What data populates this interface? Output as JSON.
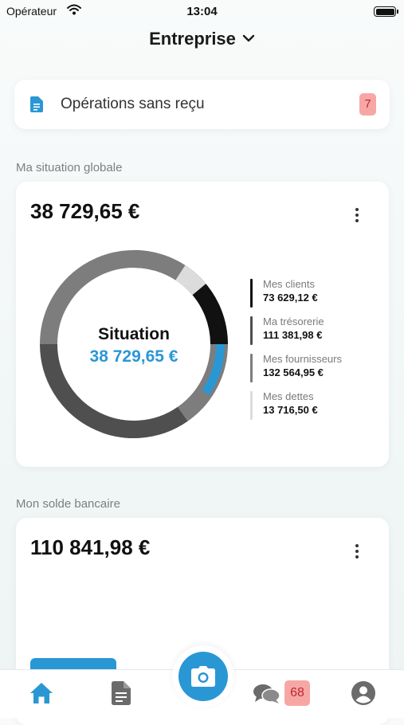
{
  "status_bar": {
    "carrier": "Opérateur",
    "time": "13:04"
  },
  "header": {
    "title": "Entreprise"
  },
  "receipts": {
    "label": "Opérations sans reçu",
    "count": "7"
  },
  "situation": {
    "section_label": "Ma situation globale",
    "total": "38 729,65 €",
    "center_title": "Situation",
    "center_value": "38 729,65 €",
    "legend": [
      {
        "label": "Mes clients",
        "value": "73 629,12 €",
        "color": "#111111"
      },
      {
        "label": "Ma trésorerie",
        "value": "111 381,98 €",
        "color": "#4f4f4f"
      },
      {
        "label": "Mes fournisseurs",
        "value": "132 564,95 €",
        "color": "#7d7d7d"
      },
      {
        "label": "Mes dettes",
        "value": "13 716,50 €",
        "color": "#dcdcdc"
      }
    ]
  },
  "bank": {
    "section_label": "Mon solde bancaire",
    "total": "110 841,98 €"
  },
  "tab_bar": {
    "items": [
      "home-icon",
      "document-icon",
      "camera-icon",
      "chat-icon",
      "profile-icon"
    ],
    "chat_badge": "68",
    "accent": "#2a97d5",
    "inactive": "#6b6b6b"
  },
  "colors": {
    "accent": "#2a97d5",
    "badge_bg": "#f7a6a6",
    "badge_text": "#c0272d"
  }
}
